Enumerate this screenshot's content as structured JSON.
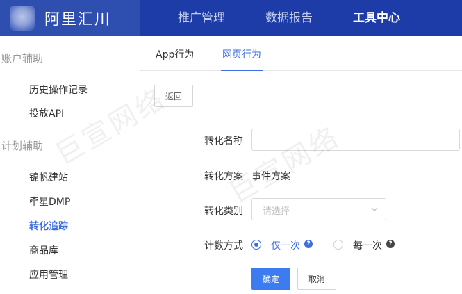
{
  "header": {
    "brand_name": "阿里汇川",
    "nav": [
      {
        "label": "推广管理"
      },
      {
        "label": "数据报告"
      },
      {
        "label": "工具中心"
      }
    ]
  },
  "sidebar": {
    "groups": [
      {
        "title": "账户辅助",
        "items": [
          {
            "label": "历史操作记录"
          },
          {
            "label": "投放API"
          }
        ]
      },
      {
        "title": "计划辅助",
        "items": [
          {
            "label": "锦帆建站"
          },
          {
            "label": "牵星DMP"
          },
          {
            "label": "转化追踪"
          },
          {
            "label": "商品库"
          },
          {
            "label": "应用管理"
          }
        ]
      }
    ],
    "active_item": "转化追踪"
  },
  "tabs": [
    {
      "label": "App行为"
    },
    {
      "label": "网页行为"
    }
  ],
  "active_tab": "网页行为",
  "back_label": "返回",
  "form": {
    "name_label": "转化名称",
    "name_value": "",
    "plan_label": "转化方案",
    "plan_value": "事件方案",
    "type_label": "转化类别",
    "type_placeholder": "请选择",
    "count_label": "计数方式",
    "count_options": [
      {
        "label": "仅一次",
        "selected": true
      },
      {
        "label": "每一次",
        "selected": false
      }
    ],
    "help_glyph": "?"
  },
  "buttons": {
    "ok": "确定",
    "cancel": "取消"
  },
  "watermark_text": "巨宣网络",
  "colors": {
    "brand_bg": "#2f4fb0",
    "nav_bg": "#1e3ca8",
    "accent": "#3d6fe0",
    "primary_button": "#3d7cf0"
  }
}
